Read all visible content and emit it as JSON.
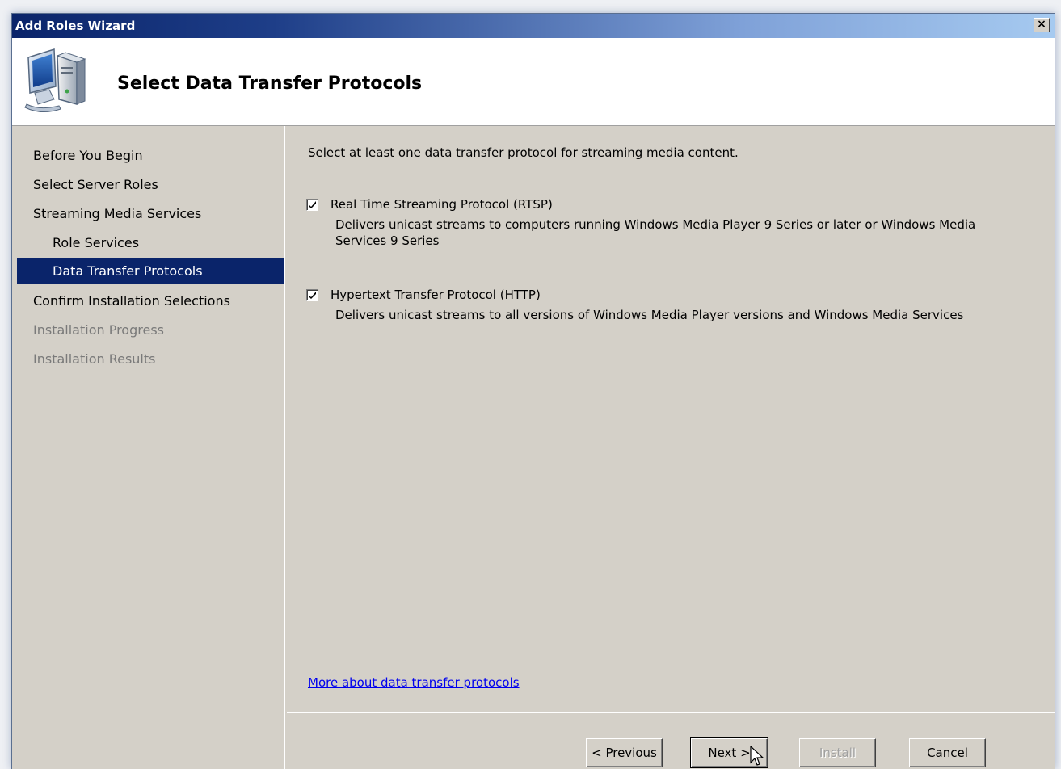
{
  "window": {
    "title": "Add Roles Wizard",
    "close_label": "×"
  },
  "header": {
    "title": "Select Data Transfer Protocols",
    "icon": "computer-server-icon"
  },
  "sidebar": {
    "items": [
      {
        "label": "Before You Begin",
        "state": "normal",
        "level": 0
      },
      {
        "label": "Select Server Roles",
        "state": "normal",
        "level": 0
      },
      {
        "label": "Streaming Media Services",
        "state": "normal",
        "level": 0
      },
      {
        "label": "Role Services",
        "state": "normal",
        "level": 1
      },
      {
        "label": "Data Transfer Protocols",
        "state": "active",
        "level": 1
      },
      {
        "label": "Confirm Installation Selections",
        "state": "normal",
        "level": 0
      },
      {
        "label": "Installation Progress",
        "state": "disabled",
        "level": 0
      },
      {
        "label": "Installation Results",
        "state": "disabled",
        "level": 0
      }
    ]
  },
  "main": {
    "intro": "Select at least one data transfer protocol for streaming media content.",
    "options": [
      {
        "label": "Real Time Streaming Protocol (RTSP)",
        "checked": true,
        "description": "Delivers unicast streams to computers running Windows Media Player 9 Series or later or Windows Media Services 9 Series"
      },
      {
        "label": "Hypertext Transfer Protocol (HTTP)",
        "checked": true,
        "description": "Delivers unicast streams to all versions of Windows Media Player versions and Windows Media Services"
      }
    ],
    "more_link": "More about data transfer protocols"
  },
  "buttons": {
    "previous": "< Previous",
    "next": "Next >",
    "install": "Install",
    "cancel": "Cancel"
  },
  "colors": {
    "title_bar_start": "#0a246a",
    "title_bar_end": "#a6caf0",
    "active_nav": "#0a246a",
    "dialog_bg": "#d4d0c8",
    "link": "#0000ee"
  }
}
